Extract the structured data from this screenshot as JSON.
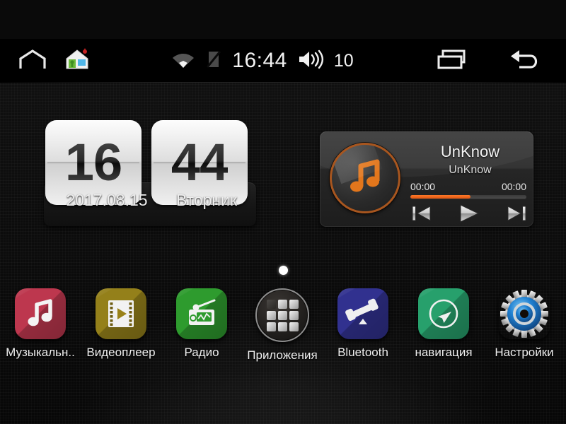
{
  "statusbar": {
    "home_icon": "home-outline-icon",
    "launcher_icon": "house-app-icon",
    "wifi_icon": "wifi-icon",
    "signal_icon": "signal-off-icon",
    "time": "16:44",
    "volume_icon": "volume-icon",
    "volume_level": "10",
    "recents_icon": "recents-icon",
    "back_icon": "back-icon"
  },
  "clock_widget": {
    "hours": "16",
    "minutes": "44",
    "date": "2017.08.15",
    "weekday": "Вторник"
  },
  "media_widget": {
    "album_art_icon": "music-note-icon",
    "title": "UnKnow",
    "artist": "UnKnow",
    "elapsed": "00:00",
    "total": "00:00",
    "progress_percent": 52,
    "prev_icon": "previous-track-icon",
    "play_icon": "play-icon",
    "next_icon": "next-track-icon",
    "accent_color": "#e8601a"
  },
  "page_indicator": {
    "pages": 1,
    "active": 0
  },
  "apps": [
    {
      "label": "Музыкальн..",
      "icon": "music-app-icon",
      "color": "#bd374e"
    },
    {
      "label": "Видеоплеер",
      "icon": "video-player-icon",
      "color": "#94801a"
    },
    {
      "label": "Радио",
      "icon": "radio-icon",
      "color": "#2e9b2e"
    },
    {
      "label": "Приложения",
      "icon": "app-drawer-icon",
      "color": "#242220"
    },
    {
      "label": "Bluetooth",
      "icon": "phone-handset-icon",
      "color": "#31318f"
    },
    {
      "label": "навигация",
      "icon": "navigation-arrow-icon",
      "color": "#27a06c"
    },
    {
      "label": "Настройки",
      "icon": "settings-gear-icon",
      "color": "#0a0a0a"
    }
  ]
}
